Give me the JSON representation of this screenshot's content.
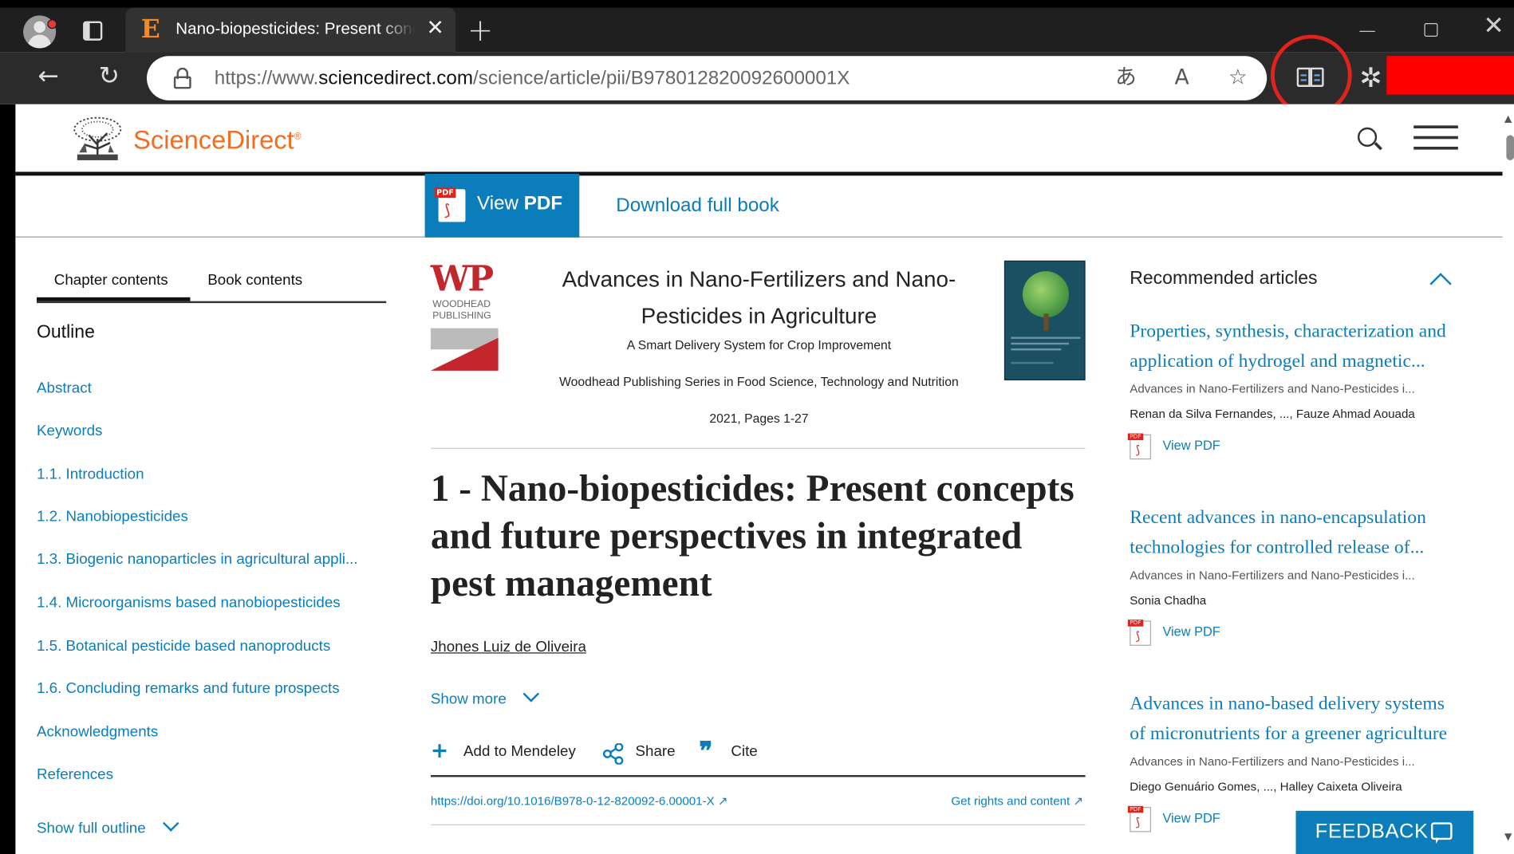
{
  "browser": {
    "tab_title": "Nano-biopesticides: Present concepts and future perspectives",
    "tab_icon_letter": "E",
    "url_prefix": "https://www.",
    "url_domain": "sciencedirect.com",
    "url_path": "/science/article/pii/B978012820092600001X",
    "annotation_color": "#e0231d"
  },
  "site": {
    "name": "ScienceDirect",
    "trademark": "®",
    "brand_color": "#f36d21",
    "accent_color": "#0c7dbb"
  },
  "pdfbar": {
    "view_pdf_prefix": "View ",
    "view_pdf_bold": "PDF",
    "download_book": "Download full book"
  },
  "sidebar": {
    "tabs": [
      "Chapter contents",
      "Book contents"
    ],
    "outline_title": "Outline",
    "items": [
      "Abstract",
      "Keywords",
      "1.1. Introduction",
      "1.2. Nanobiopesticides",
      "1.3. Biogenic nanoparticles in agricultural appli...",
      "1.4. Microorganisms based nanobiopesticides",
      "1.5. Botanical pesticide based nanoproducts",
      "1.6. Concluding remarks and future prospects",
      "Acknowledgments",
      "References"
    ],
    "show_full": "Show full outline"
  },
  "book": {
    "publisher_letters": "WP",
    "publisher_line1": "WOODHEAD",
    "publisher_line2": "PUBLISHING",
    "title": "Advances in Nano-Fertilizers and Nano-Pesticides in Agriculture",
    "subtitle": "A Smart Delivery System for Crop Improvement",
    "series": "Woodhead Publishing Series in Food Science, Technology and Nutrition",
    "pages": "2021, Pages 1-27"
  },
  "article": {
    "title": "1 - Nano-biopesticides: Present concepts and future perspectives in integrated pest management",
    "author": "Jhones Luiz de Oliveira",
    "show_more": "Show more",
    "actions": {
      "mendeley": "Add to Mendeley",
      "share": "Share",
      "cite": "Cite"
    },
    "doi": "https://doi.org/10.1016/B978-0-12-820092-6.00001-X",
    "rights": "Get rights and content"
  },
  "recommended": {
    "title": "Recommended articles",
    "items": [
      {
        "title": "Properties, synthesis, characterization and application of hydrogel and magnetic...",
        "source": "Advances in Nano-Fertilizers and Nano-Pesticides i...",
        "authors": "Renan da Silva Fernandes, ..., Fauze Ahmad Aouada",
        "pdf": "View PDF"
      },
      {
        "title": "Recent advances in nano-encapsulation technologies for controlled release of...",
        "source": "Advances in Nano-Fertilizers and Nano-Pesticides i...",
        "authors": "Sonia Chadha",
        "pdf": "View PDF"
      },
      {
        "title": "Advances in nano-based delivery systems of micronutrients for a greener agriculture",
        "source": "Advances in Nano-Fertilizers and Nano-Pesticides i...",
        "authors": "Diego Genuário Gomes, ..., Halley Caixeta Oliveira",
        "pdf": "View PDF"
      }
    ]
  },
  "feedback": {
    "label": "FEEDBACK"
  }
}
